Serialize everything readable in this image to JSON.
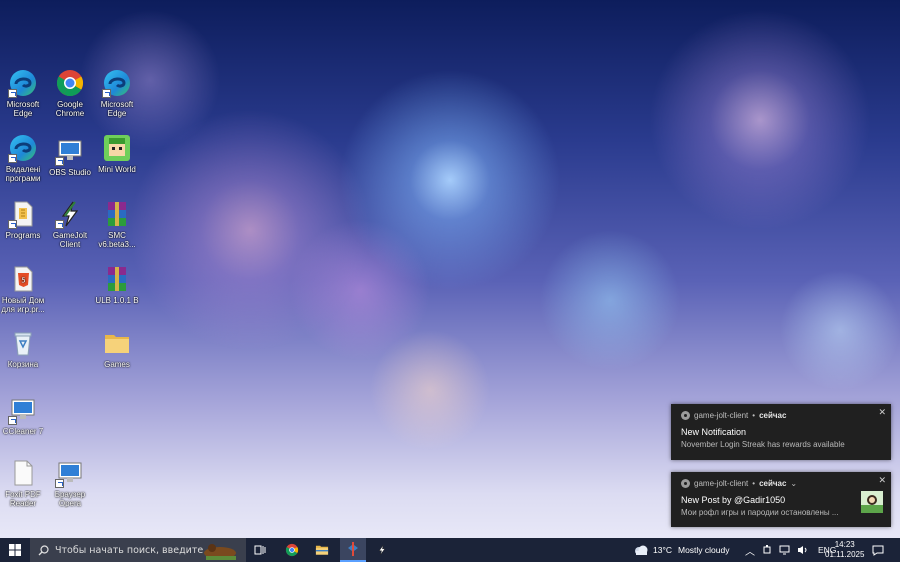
{
  "desktop": {
    "icons": [
      {
        "label": "Microsoft Edge",
        "icon": "edge-icon"
      },
      {
        "label": "Google Chrome",
        "icon": "chrome-icon"
      },
      {
        "label": "Microsoft Edge",
        "icon": "edge-icon"
      },
      {
        "label": "Видалені програми",
        "icon": "edge-icon"
      },
      {
        "label": "OBS Studio",
        "icon": "monitor-icon"
      },
      {
        "label": "Mini World",
        "icon": "mini-world-icon"
      },
      {
        "label": "Programs",
        "icon": "document-icon"
      },
      {
        "label": "GameJolt Client",
        "icon": "gamejolt-icon"
      },
      {
        "label": "SMC v6.beta3...",
        "icon": "winrar-archive-icon"
      },
      {
        "label": "Новый Дом для игр.pr...",
        "icon": "html-file-icon"
      },
      {
        "label": "ULB 1.0.1 B",
        "icon": "winrar-archive-icon"
      },
      {
        "label": "Корзина",
        "icon": "recycle-bin-icon"
      },
      {
        "label": "Games",
        "icon": "folder-icon"
      },
      {
        "label": "CCleaner 7",
        "icon": "monitor-icon"
      },
      {
        "label": "Foxit PDF Reader",
        "icon": "document-icon"
      },
      {
        "label": "Браузер Opera",
        "icon": "monitor-icon"
      }
    ]
  },
  "notifications": [
    {
      "app": "game-jolt-client",
      "time": "сейчас",
      "title": "New Notification",
      "body": "November Login Streak has rewards available"
    },
    {
      "app": "game-jolt-client",
      "time": "сейчас",
      "title": "New Post by @Gadir1050",
      "body": "Мои рофл игры и пародии остановлены ..."
    }
  ],
  "taskbar": {
    "search_placeholder": "Чтобы начать поиск, введите",
    "weather_temp": "13°C",
    "weather_desc": "Mostly cloudy",
    "language": "ENG",
    "time": "14:23",
    "date": "01.11.2025"
  },
  "colors": {
    "taskbar_bg": "#1b2338",
    "toast_bg": "#202020",
    "accent": "#5aa0ff"
  }
}
